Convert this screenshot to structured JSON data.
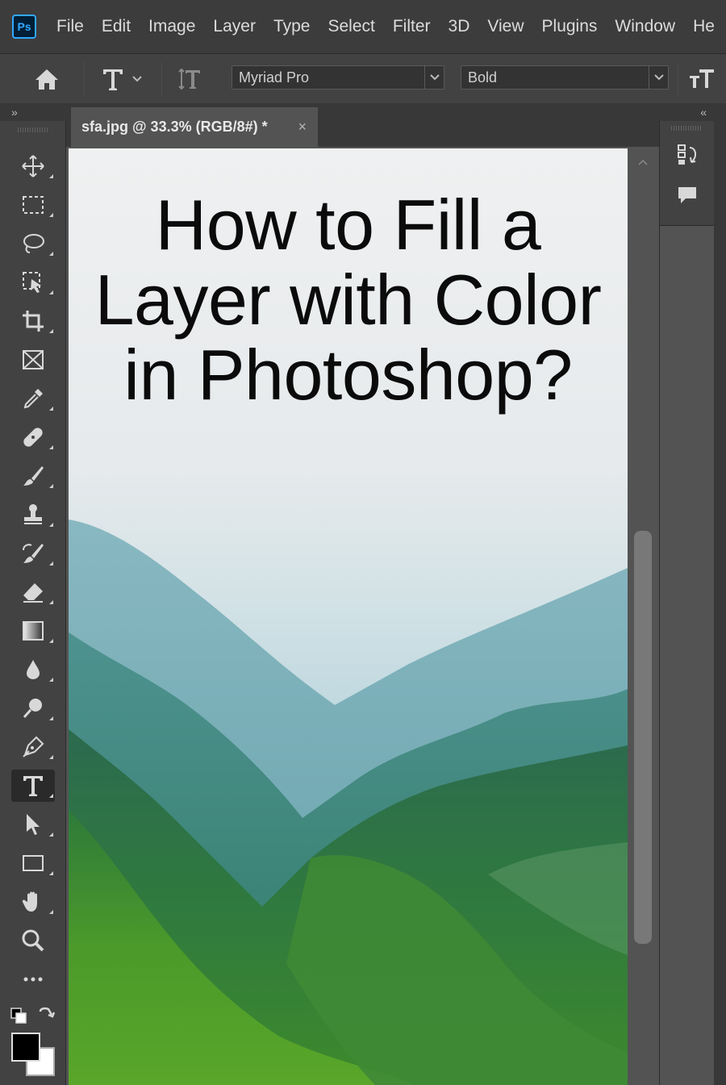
{
  "menubar": {
    "logo": "Ps",
    "items": [
      "File",
      "Edit",
      "Image",
      "Layer",
      "Type",
      "Select",
      "Filter",
      "3D",
      "View",
      "Plugins",
      "Window",
      "He"
    ]
  },
  "options_bar": {
    "font_family": "Myriad Pro",
    "font_style": "Bold"
  },
  "panels": {
    "left_collapse": "»",
    "right_collapse": "«"
  },
  "document": {
    "tab_title": "sfa.jpg @ 33.3% (RGB/8#) *",
    "close_glyph": "×",
    "headline_lines": [
      "How to Fill a",
      "Layer with Color",
      "in Photoshop?"
    ]
  },
  "toolbar": {
    "active_tool": "type-tool"
  },
  "colors": {
    "foreground": "#000000",
    "background": "#ffffff"
  }
}
